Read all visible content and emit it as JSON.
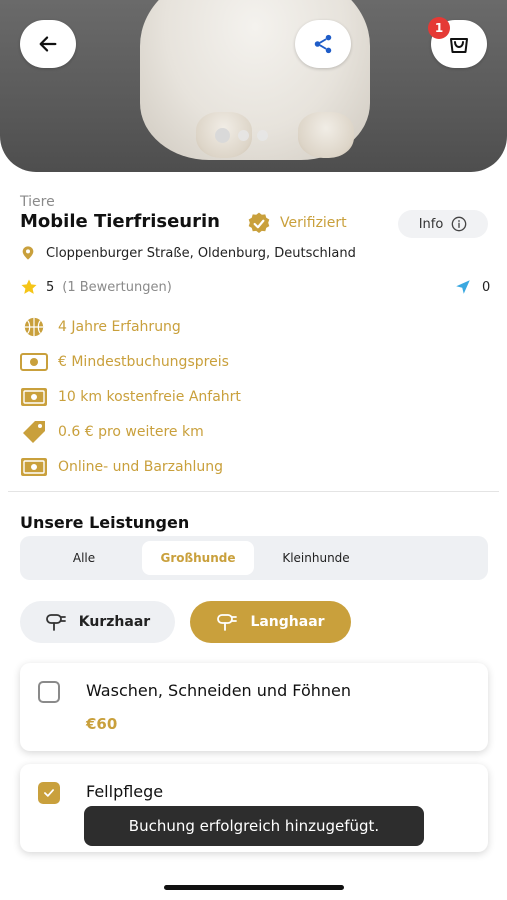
{
  "hero": {
    "image": "white-dog-paws-photo",
    "carousel_pages": 3,
    "active_page": 1
  },
  "header": {
    "back_icon": "arrow-left-icon",
    "share_icon": "share-icon",
    "cart_icon": "shopping-bag-icon",
    "cart_count": "1"
  },
  "provider": {
    "category": "Tiere",
    "name": "Mobile Tierfriseurin",
    "verified_label": "Verifiziert",
    "info_label": "Info",
    "address": "Cloppenburger Straße, Oldenburg, Deutschland",
    "rating": "5",
    "rating_count": "(1 Bewertungen)",
    "distance": "0"
  },
  "features": [
    {
      "icon": "basketball-icon",
      "text": "4 Jahre Erfahrung"
    },
    {
      "icon": "banknote-icon",
      "text": "€ Mindestbuchungspreis"
    },
    {
      "icon": "money-icon",
      "text": "10 km kostenfreie Anfahrt"
    },
    {
      "icon": "price-tag-icon",
      "text": "0.6 € pro weitere km"
    },
    {
      "icon": "cash-icon",
      "text": "Online- und Barzahlung"
    }
  ],
  "services": {
    "title": "Unsere Leistungen",
    "tabs": [
      "Alle",
      "Großhunde",
      "Kleinhunde"
    ],
    "active_tab": "Großhunde",
    "filters": [
      "Kurzhaar",
      "Langhaar"
    ],
    "active_filter": "Langhaar",
    "items": [
      {
        "name": "Waschen, Schneiden und Föhnen",
        "price": "€60",
        "checked": false
      },
      {
        "name": "Fellpflege",
        "price": "",
        "checked": true
      }
    ]
  },
  "toast": "Buchung erfolgreich hinzugefügt.",
  "colors": {
    "accent": "#c9a03c",
    "badge": "#e53935",
    "toast_bg": "#2d2d2d"
  }
}
